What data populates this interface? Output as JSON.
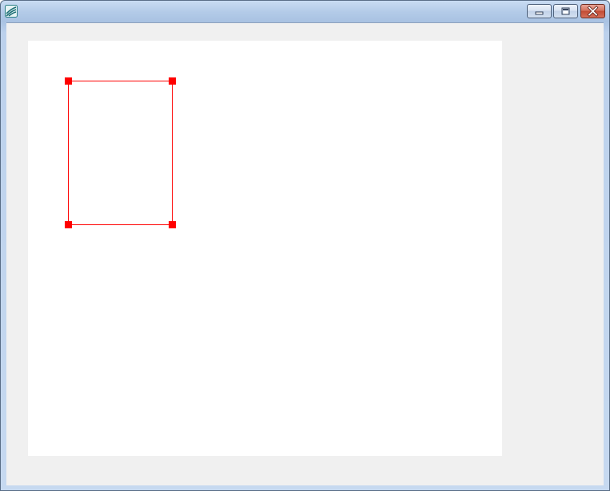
{
  "window": {
    "title": "",
    "icon": "app-icon"
  },
  "caption_buttons": {
    "minimize_icon": "minimize-icon",
    "maximize_icon": "maximize-icon",
    "close_icon": "close-icon"
  },
  "canvas": {
    "shape": {
      "type": "rectangle",
      "stroke_color": "#ff0000",
      "handle_color": "#ff0000",
      "selected": true,
      "handles": [
        "top-left-handle",
        "top-right-handle",
        "bottom-left-handle",
        "bottom-right-handle"
      ]
    }
  },
  "colors": {
    "client_background": "#f0f0f0",
    "canvas_background": "#ffffff",
    "close_button": "#c24b34"
  }
}
